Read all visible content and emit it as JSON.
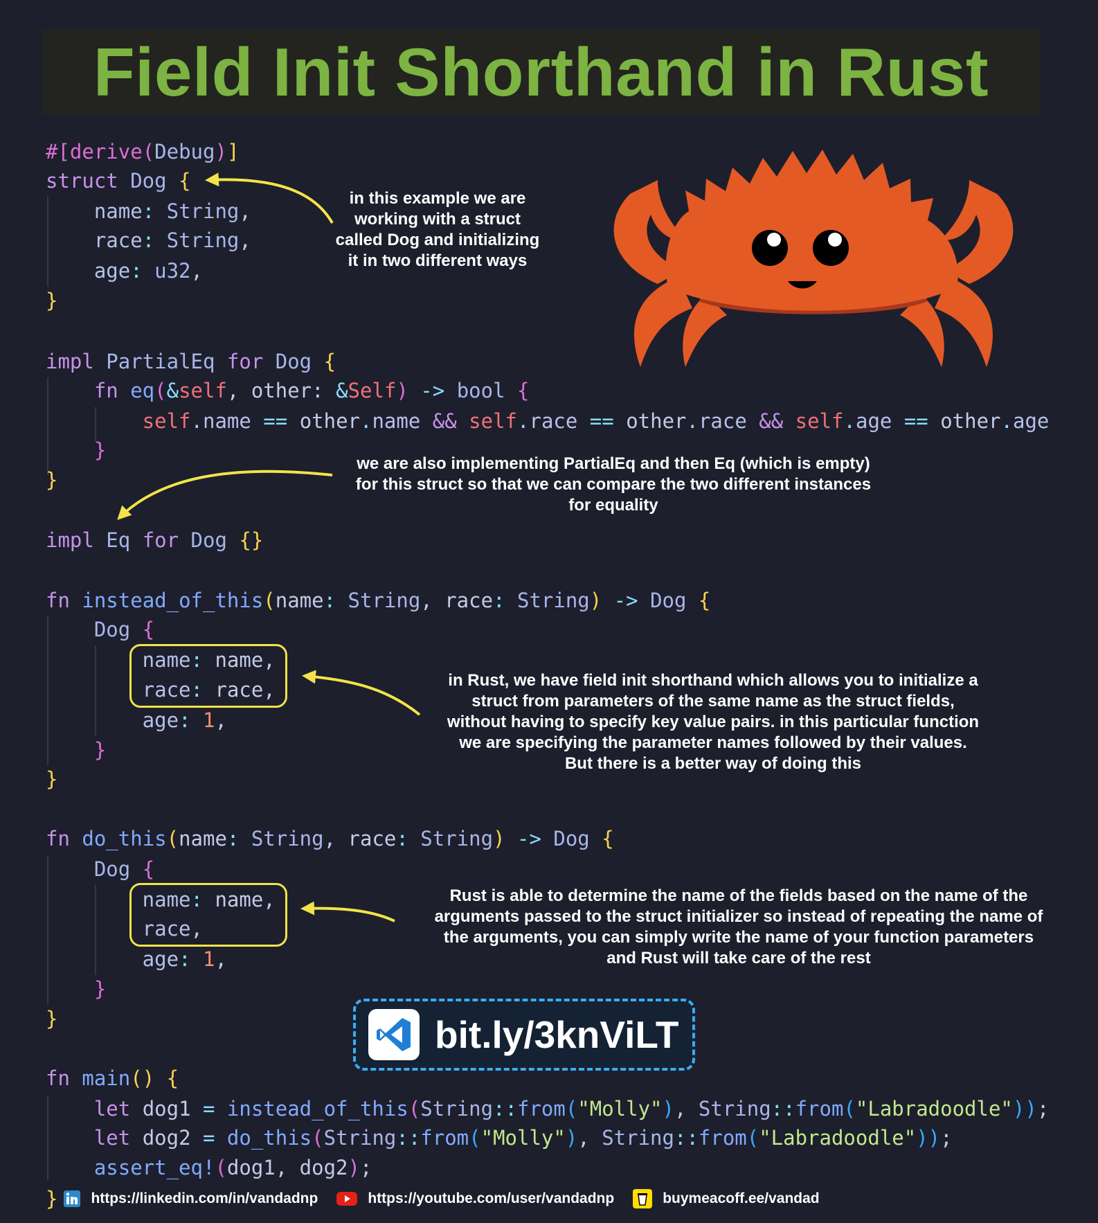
{
  "title": "Field Init Shorthand in Rust",
  "notes": {
    "struct": [
      "in this example we are",
      "working with a struct",
      "called Dog and initializing",
      "it in two different ways"
    ],
    "partial_eq": [
      "we are also implementing PartialEq and then Eq (which is empty)",
      "for this struct so that we can compare the two different instances",
      "for equality"
    ],
    "shorthand": [
      "in Rust, we have field init shorthand which allows you to initialize a",
      "struct from parameters of the same name as the struct fields,",
      "without having to specify key value pairs. in this particular function",
      "we are specifying the parameter names followed by their values.",
      "But there is a better way of doing this"
    ],
    "better": [
      "Rust is able to determine the name of the fields based on the name of the",
      "arguments passed to the struct initializer so instead of repeating the name of",
      "the arguments, you can simply write the name of your function parameters",
      "and Rust will take care of the rest"
    ]
  },
  "badge": {
    "url": "bit.ly/3knViLT",
    "icon": "vscode-icon"
  },
  "footer": {
    "brace": "}",
    "links": [
      {
        "icon": "linkedin-icon",
        "text": "https://linkedin.com/in/vandadnp"
      },
      {
        "icon": "youtube-icon",
        "text": "https://youtube.com/user/vandadnp"
      },
      {
        "icon": "coffee-cup-icon",
        "text": "buymeacoff.ee/vandad"
      }
    ]
  },
  "colors": {
    "background": "#1d1f2c",
    "title_green": "#7cb342",
    "keyword": "#c792ea",
    "function": "#82aaff",
    "self": "#f07178",
    "string": "#c3e88d",
    "number": "#f78c6c",
    "bracket_yellow": "#ffd34e",
    "highlight_box": "#f2e34a",
    "crab": "#e45a25"
  },
  "code": [
    [
      [
        "#[derive",
        "b2"
      ],
      [
        "(",
        "b2"
      ],
      [
        "Debug",
        "ty"
      ],
      [
        ")",
        "b2"
      ],
      [
        "]",
        "b1"
      ]
    ],
    [
      [
        "struct",
        "kw"
      ],
      [
        " Dog ",
        "ty"
      ],
      [
        "{",
        "b1"
      ]
    ],
    [
      [
        "    name",
        "prop"
      ],
      [
        ": ",
        "op"
      ],
      [
        "String",
        "ty"
      ],
      [
        ",",
        "id"
      ]
    ],
    [
      [
        "    race",
        "prop"
      ],
      [
        ": ",
        "op"
      ],
      [
        "String",
        "ty"
      ],
      [
        ",",
        "id"
      ]
    ],
    [
      [
        "    age",
        "prop"
      ],
      [
        ": ",
        "op"
      ],
      [
        "u32",
        "ty"
      ],
      [
        ",",
        "id"
      ]
    ],
    [
      [
        "}",
        "b1"
      ]
    ],
    [
      [
        "impl",
        "kw"
      ],
      [
        " PartialEq ",
        "ty"
      ],
      [
        "for",
        "kw"
      ],
      [
        " Dog ",
        "ty"
      ],
      [
        "{",
        "b1"
      ]
    ],
    [
      [
        "    fn ",
        "kw"
      ],
      [
        "eq",
        "fnn"
      ],
      [
        "(",
        "b2"
      ],
      [
        "&",
        "op"
      ],
      [
        "self",
        "self"
      ],
      [
        ", other: ",
        "id"
      ],
      [
        "&",
        "op"
      ],
      [
        "Self",
        "self"
      ],
      [
        ") ",
        "b2"
      ],
      [
        "-> ",
        "op"
      ],
      [
        "bool ",
        "ty"
      ],
      [
        "{",
        "b2"
      ]
    ],
    [
      [
        "        self",
        "self"
      ],
      [
        ".",
        "op"
      ],
      [
        "name ",
        "prop"
      ],
      [
        "== ",
        "op"
      ],
      [
        "other",
        "id"
      ],
      [
        ".",
        "op"
      ],
      [
        "name ",
        "prop"
      ],
      [
        "&& ",
        "kw"
      ],
      [
        "self",
        "self"
      ],
      [
        ".",
        "op"
      ],
      [
        "race ",
        "prop"
      ],
      [
        "== ",
        "op"
      ],
      [
        "other",
        "id"
      ],
      [
        ".",
        "op"
      ],
      [
        "race ",
        "prop"
      ],
      [
        "&& ",
        "kw"
      ],
      [
        "self",
        "self"
      ],
      [
        ".",
        "op"
      ],
      [
        "age ",
        "prop"
      ],
      [
        "== ",
        "op"
      ],
      [
        "other",
        "id"
      ],
      [
        ".",
        "op"
      ],
      [
        "age",
        "prop"
      ]
    ],
    [
      [
        "    }",
        "b2"
      ]
    ],
    [
      [
        "}",
        "b1"
      ]
    ],
    [
      [
        "impl",
        "kw"
      ],
      [
        " Eq ",
        "ty"
      ],
      [
        "for",
        "kw"
      ],
      [
        " Dog ",
        "ty"
      ],
      [
        "{}",
        "b1"
      ]
    ],
    [
      [
        "fn ",
        "kw"
      ],
      [
        "instead_of_this",
        "fnn"
      ],
      [
        "(",
        "b1"
      ],
      [
        "name",
        "id"
      ],
      [
        ": ",
        "op"
      ],
      [
        "String",
        "ty"
      ],
      [
        ", ",
        "id"
      ],
      [
        "race",
        "id"
      ],
      [
        ": ",
        "op"
      ],
      [
        "String",
        "ty"
      ],
      [
        ") ",
        "b1"
      ],
      [
        "-> ",
        "op"
      ],
      [
        "Dog ",
        "ty"
      ],
      [
        "{",
        "b1"
      ]
    ],
    [
      [
        "    Dog ",
        "ty"
      ],
      [
        "{",
        "b2"
      ]
    ],
    [
      [
        "        name",
        "prop"
      ],
      [
        ": ",
        "op"
      ],
      [
        "name",
        "id"
      ],
      [
        ",",
        "id"
      ]
    ],
    [
      [
        "        race",
        "prop"
      ],
      [
        ": ",
        "op"
      ],
      [
        "race",
        "id"
      ],
      [
        ",",
        "id"
      ]
    ],
    [
      [
        "        age",
        "prop"
      ],
      [
        ": ",
        "op"
      ],
      [
        "1",
        "num"
      ],
      [
        ",",
        "id"
      ]
    ],
    [
      [
        "    }",
        "b2"
      ]
    ],
    [
      [
        "}",
        "b1"
      ]
    ],
    [
      [
        "fn ",
        "kw"
      ],
      [
        "do_this",
        "fnn"
      ],
      [
        "(",
        "b1"
      ],
      [
        "name",
        "id"
      ],
      [
        ": ",
        "op"
      ],
      [
        "String",
        "ty"
      ],
      [
        ", ",
        "id"
      ],
      [
        "race",
        "id"
      ],
      [
        ": ",
        "op"
      ],
      [
        "String",
        "ty"
      ],
      [
        ") ",
        "b1"
      ],
      [
        "-> ",
        "op"
      ],
      [
        "Dog ",
        "ty"
      ],
      [
        "{",
        "b1"
      ]
    ],
    [
      [
        "    Dog ",
        "ty"
      ],
      [
        "{",
        "b2"
      ]
    ],
    [
      [
        "        name",
        "prop"
      ],
      [
        ": ",
        "op"
      ],
      [
        "name",
        "id"
      ],
      [
        ",",
        "id"
      ]
    ],
    [
      [
        "        race",
        "prop"
      ],
      [
        ",",
        "id"
      ]
    ],
    [
      [
        "        age",
        "prop"
      ],
      [
        ": ",
        "op"
      ],
      [
        "1",
        "num"
      ],
      [
        ",",
        "id"
      ]
    ],
    [
      [
        "    }",
        "b2"
      ]
    ],
    [
      [
        "}",
        "b1"
      ]
    ],
    [
      [
        "fn ",
        "kw"
      ],
      [
        "main",
        "fnn"
      ],
      [
        "() ",
        "b1"
      ],
      [
        "{",
        "b1"
      ]
    ],
    [
      [
        "    let ",
        "kw"
      ],
      [
        "dog1 ",
        "id"
      ],
      [
        "= ",
        "op"
      ],
      [
        "instead_of_this",
        "fnn"
      ],
      [
        "(",
        "b2"
      ],
      [
        "String",
        "ty"
      ],
      [
        "::",
        "op"
      ],
      [
        "from",
        "fnn"
      ],
      [
        "(",
        "b3"
      ],
      [
        "\"Molly\"",
        "str"
      ],
      [
        ")",
        "b3"
      ],
      [
        ", ",
        "id"
      ],
      [
        "String",
        "ty"
      ],
      [
        "::",
        "op"
      ],
      [
        "from",
        "fnn"
      ],
      [
        "(",
        "b3"
      ],
      [
        "\"Labradoodle\"",
        "str"
      ],
      [
        "))",
        "b3"
      ],
      [
        ";",
        "id"
      ]
    ],
    [
      [
        "    let ",
        "kw"
      ],
      [
        "dog2 ",
        "id"
      ],
      [
        "= ",
        "op"
      ],
      [
        "do_this",
        "fnn"
      ],
      [
        "(",
        "b2"
      ],
      [
        "String",
        "ty"
      ],
      [
        "::",
        "op"
      ],
      [
        "from",
        "fnn"
      ],
      [
        "(",
        "b3"
      ],
      [
        "\"Molly\"",
        "str"
      ],
      [
        ")",
        "b3"
      ],
      [
        ", ",
        "id"
      ],
      [
        "String",
        "ty"
      ],
      [
        "::",
        "op"
      ],
      [
        "from",
        "fnn"
      ],
      [
        "(",
        "b3"
      ],
      [
        "\"Labradoodle\"",
        "str"
      ],
      [
        "))",
        "b3"
      ],
      [
        ";",
        "id"
      ]
    ],
    [
      [
        "    assert_eq!",
        "fnn"
      ],
      [
        "(",
        "b2"
      ],
      [
        "dog1, dog2",
        "id"
      ],
      [
        ")",
        "b2"
      ],
      [
        ";",
        "id"
      ]
    ]
  ]
}
